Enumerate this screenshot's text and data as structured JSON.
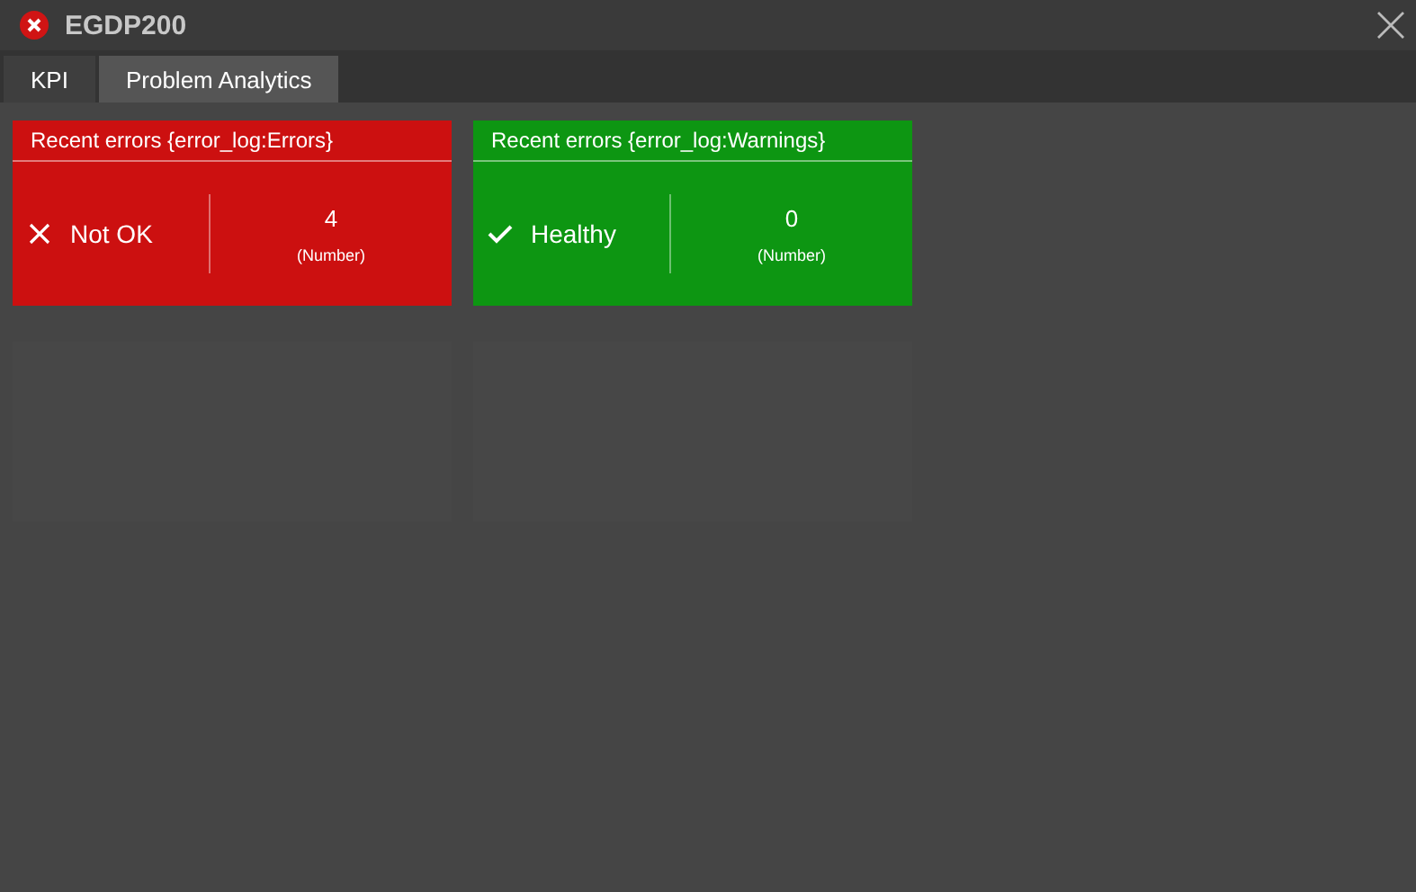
{
  "window": {
    "title": "EGDP200"
  },
  "tabs": [
    {
      "label": "KPI",
      "selected": false
    },
    {
      "label": "Problem Analytics",
      "selected": true
    }
  ],
  "cards": [
    {
      "title": "Recent errors {error_log:Errors}",
      "kind": "error",
      "status_label": "Not OK",
      "value": "4",
      "unit": "(Number)"
    },
    {
      "title": "Recent errors {error_log:Warnings}",
      "kind": "ok",
      "status_label": "Healthy",
      "value": "0",
      "unit": "(Number)"
    }
  ]
}
